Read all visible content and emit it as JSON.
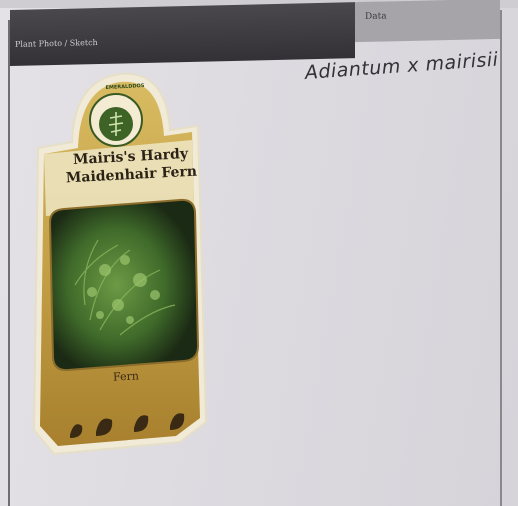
{
  "sheet": {
    "header_label": "Plant Photo / Sketch",
    "header_right_label": "Data",
    "handwritten_note": "Adiantum x mairisii"
  },
  "plant_tag": {
    "brand": "EMERALDDOS",
    "title_line1": "Mairis's Hardy",
    "title_line2": "Maidenhair Fern",
    "type_label": "Fern"
  },
  "colors": {
    "header_dark": "#3d3b40",
    "tag_gold": "#c9a44a",
    "tag_cream": "#efe6c6",
    "fern_green": "#3f6a2a"
  }
}
